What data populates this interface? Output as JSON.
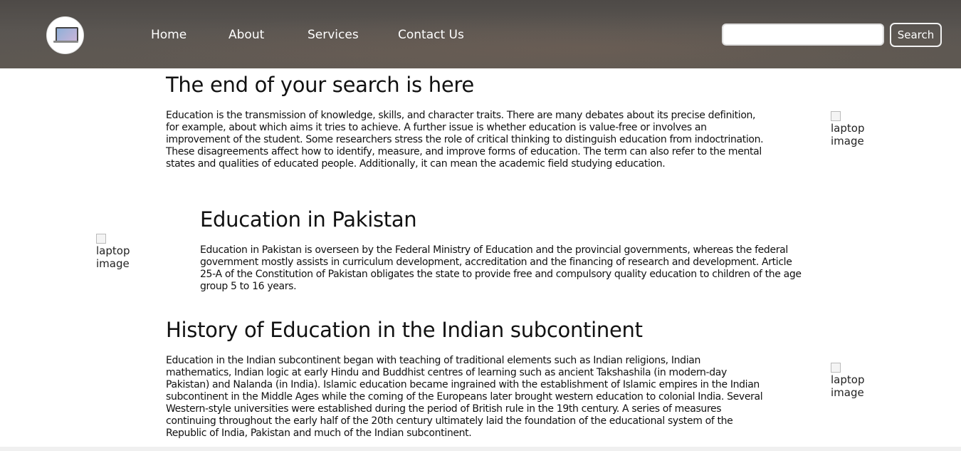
{
  "header": {
    "logo_icon": "laptop-icon",
    "nav": [
      "Home",
      "About",
      "Services",
      "Contact Us"
    ],
    "search": {
      "value": "",
      "placeholder": "",
      "button_label": "Search"
    }
  },
  "sections": [
    {
      "title": "The end of your search is here",
      "body": "Education is the transmission of knowledge, skills, and character traits. There are many debates about its precise definition, for example, about which aims it tries to achieve. A further issue is whether education is value-free or involves an improvement of the student. Some researchers stress the role of critical thinking to distinguish education from indoctrination. These disagreements affect how to identify, measure, and improve forms of education. The term can also refer to the mental states and qualities of educated people. Additionally, it can mean the academic field studying education.",
      "image_alt": "laptop image"
    },
    {
      "title": "Education in Pakistan",
      "body": "Education in Pakistan is overseen by the Federal Ministry of Education and the provincial governments, whereas the federal government mostly assists in curriculum development, accreditation and the financing of research and development. Article 25-A of the Constitution of Pakistan obligates the state to provide free and compulsory quality education to children of the age group 5 to 16 years.",
      "image_alt": "laptop image"
    },
    {
      "title": "History of Education in the Indian subcontinent",
      "body": "Education in the Indian subcontinent began with teaching of traditional elements such as Indian religions, Indian mathematics, Indian logic at early Hindu and Buddhist centres of learning such as ancient Takshashila (in modern-day Pakistan) and Nalanda (in India). Islamic education became ingrained with the establishment of Islamic empires in the Indian subcontinent in the Middle Ages while the coming of the Europeans later brought western education to colonial India. Several Western-style universities were established during the period of British rule in the 19th century. A series of measures continuing throughout the early half of the 20th century ultimately laid the foundation of the educational system of the Republic of India, Pakistan and much of the Indian subcontinent.",
      "image_alt": "laptop image"
    }
  ]
}
